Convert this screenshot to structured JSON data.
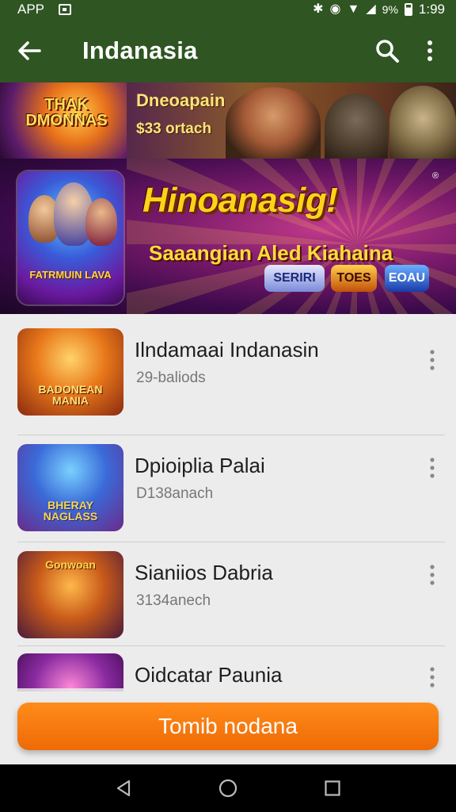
{
  "status_bar": {
    "label": "APP",
    "battery_text": "9%",
    "time": "1:99",
    "icons": [
      "notification-icon",
      "bluetooth-icon",
      "alarm-icon",
      "wifi-icon",
      "signal-icon",
      "battery-icon"
    ]
  },
  "app_bar": {
    "title": "Indanasia",
    "icons": [
      "back-arrow-icon",
      "search-icon",
      "more-vert-icon"
    ]
  },
  "banner_top": {
    "logo_text": "THAK DMONNAS",
    "title": "Dneoapain",
    "subtitle": "$33 ortach"
  },
  "banner_main": {
    "art_badge": "FATRMUIN LAVA",
    "title": "Hinoanasig!",
    "subtitle": "Saaangian Aled Kiahaina",
    "registered": "®",
    "tags": [
      "SERIRI",
      "TOES",
      "EOAU"
    ]
  },
  "list": {
    "items": [
      {
        "title": "Ilndamaai Indanasin",
        "subtitle": "29-baliods",
        "thumb_label": "BADONEAN MANIA"
      },
      {
        "title": "Dpioiplia Palai",
        "subtitle": "D138anach",
        "thumb_label": "BHERAY NAGLASS"
      },
      {
        "title": "Sianiios Dabria",
        "subtitle": "3134anech",
        "thumb_label": "Gonwoan"
      },
      {
        "title": "Oidcatar Paunia",
        "subtitle": "",
        "thumb_label": ""
      }
    ]
  },
  "cta": {
    "label": "Tomib nodana"
  },
  "nav_bar": {
    "icons": [
      "back-triangle-icon",
      "home-circle-icon",
      "recents-square-icon"
    ]
  },
  "colors": {
    "app_bar": "#2f5522",
    "cta": "#ff7a0e",
    "background": "#ececec"
  }
}
